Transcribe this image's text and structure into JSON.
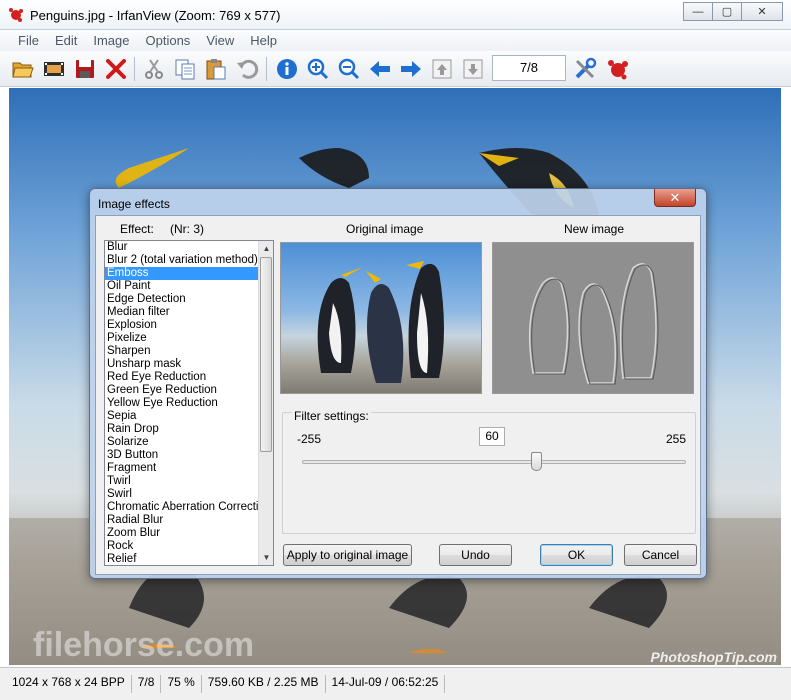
{
  "window": {
    "title": "Penguins.jpg - IrfanView (Zoom: 769 x 577)",
    "minimize": "—",
    "maximize": "▢",
    "close": "✕"
  },
  "menu": [
    "File",
    "Edit",
    "Image",
    "Options",
    "View",
    "Help"
  ],
  "toolbar": {
    "page_indicator": "7/8",
    "icons": [
      "open-icon",
      "slideshow-icon",
      "save-icon",
      "delete-icon",
      "cut-icon",
      "copy-icon",
      "paste-icon",
      "undo-icon",
      "info-icon",
      "zoom-in-icon",
      "zoom-out-icon",
      "previous-icon",
      "next-icon",
      "first-page-icon",
      "last-page-icon",
      "settings-icon",
      "irfanview-logo-icon"
    ]
  },
  "watermarks": {
    "left": "filehorse.com",
    "right": "PhotoshopTip.com"
  },
  "statusbar": {
    "dimensions": "1024 x 768 x 24 BPP",
    "index": "7/8",
    "zoom": "75 %",
    "filesize": "759.60 KB / 2.25 MB",
    "datetime": "14-Jul-09 / 06:52:25"
  },
  "dialog": {
    "title": "Image effects",
    "close": "✕",
    "effect_label": "Effect:",
    "nr_label": "(Nr: 3)",
    "original_label": "Original image",
    "new_label": "New image",
    "effects": [
      "Blur",
      "Blur 2 (total variation method)",
      "Emboss",
      "Oil Paint",
      "Edge Detection",
      "Median filter",
      "Explosion",
      "Pixelize",
      "Sharpen",
      "Unsharp mask",
      "Red Eye Reduction",
      "Green Eye Reduction",
      "Yellow Eye Reduction",
      "Sepia",
      "Rain Drop",
      "Solarize",
      "3D Button",
      "Fragment",
      "Twirl",
      "Swirl",
      "Chromatic Aberration Correction",
      "Radial Blur",
      "Zoom Blur",
      "Rock",
      "Relief"
    ],
    "selected_effect": "Emboss",
    "filter_settings_label": "Filter settings:",
    "min": "-255",
    "max": "255",
    "value": "60",
    "slider_level": 60,
    "buttons": {
      "apply": "Apply to original image",
      "undo": "Undo",
      "ok": "OK",
      "cancel": "Cancel"
    }
  },
  "colors": {
    "selection": "#3399ff",
    "accent_blue": "#1e6fd0",
    "accent_red": "#d01a1a"
  }
}
